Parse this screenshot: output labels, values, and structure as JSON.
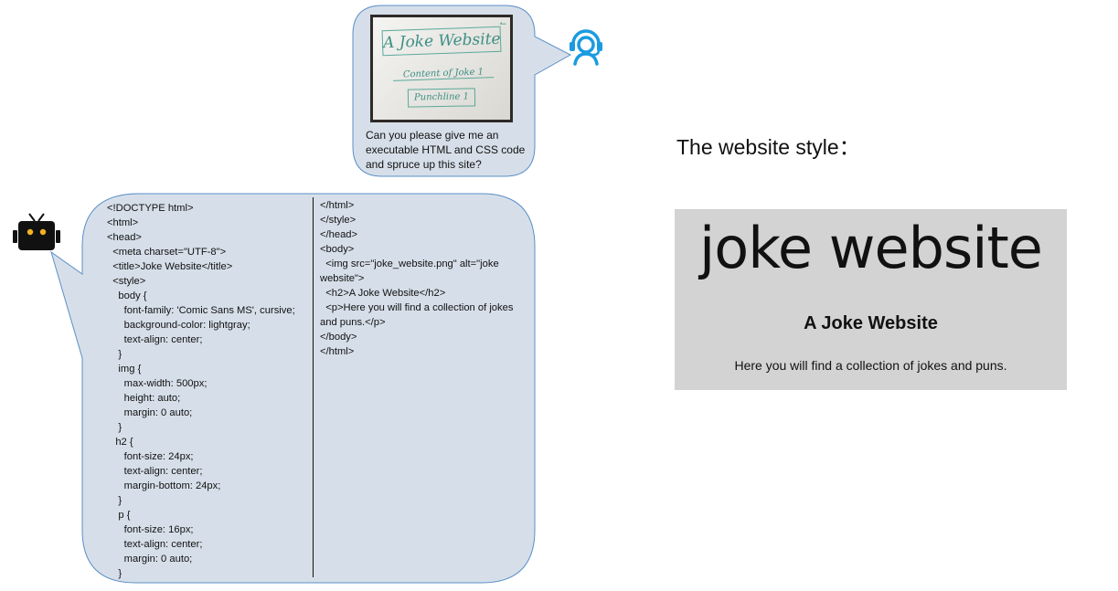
{
  "user_message": {
    "photo_text": {
      "title": "A Joke Website",
      "content": "Content of Joke 1",
      "punchline": "Punchline 1"
    },
    "lines": [
      "Can you please give me an",
      "executable HTML and CSS code",
      "and spruce up this site?"
    ]
  },
  "bot_message": {
    "code_left": [
      "<!DOCTYPE html>",
      "<html>",
      "<head>",
      "  <meta charset=\"UTF-8\">",
      "  <title>Joke Website</title>",
      "  <style>",
      "    body {",
      "      font-family: 'Comic Sans MS', cursive;",
      "      background-color: lightgray;",
      "      text-align: center;",
      "    }",
      "    img {",
      "      max-width: 500px;",
      "      height: auto;",
      "      margin: 0 auto;",
      "    }",
      "   h2 {",
      "      font-size: 24px;",
      "      text-align: center;",
      "      margin-bottom: 24px;",
      "    }",
      "    p {",
      "      font-size: 16px;",
      "      text-align: center;",
      "      margin: 0 auto;",
      "    }"
    ],
    "code_right": [
      "</html>",
      "</style>",
      "</head>",
      "<body>",
      "  <img src=\"joke_website.png\" alt=\"joke website\">",
      "  <h2>A Joke Website</h2>",
      "  <p>Here you will find a collection of jokes and puns.</p>",
      "</body>",
      "</html>"
    ]
  },
  "result": {
    "heading": "The website style：",
    "preview": {
      "big_title": "joke website",
      "h2": "A Joke Website",
      "p": "Here you will find a collection of jokes and puns."
    }
  },
  "colors": {
    "bubble_fill": "#d6dfe9",
    "bubble_stroke": "#5b8fc7",
    "agent_icon": "#1a9be0",
    "preview_bg": "#d3d3d3"
  },
  "icons": {
    "user": "headset-agent-icon",
    "bot": "robot-icon"
  }
}
